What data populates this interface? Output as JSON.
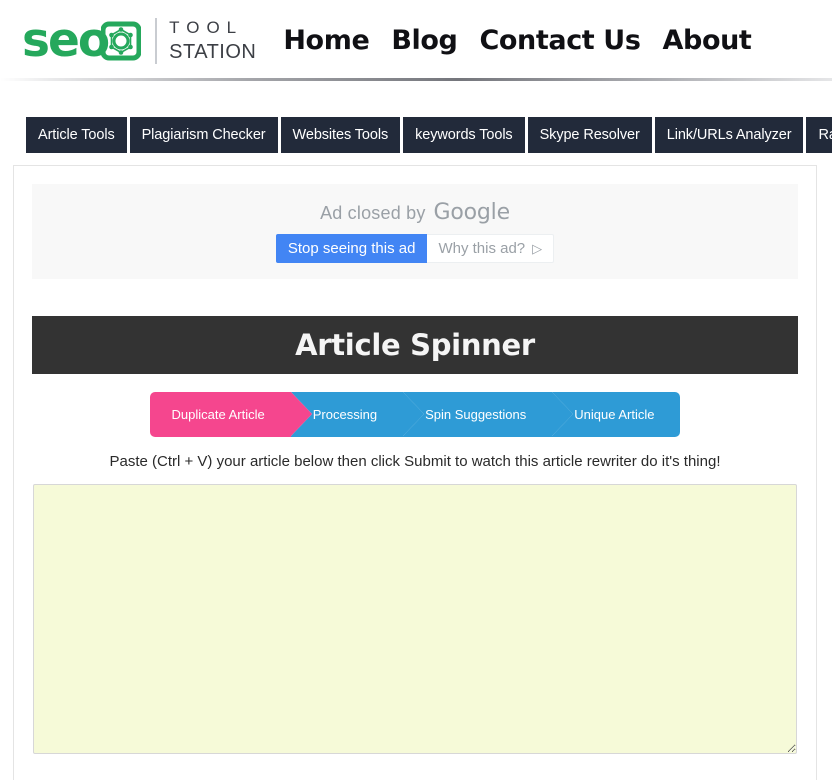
{
  "header": {
    "logo": {
      "seo_text": "seo",
      "tool_text": "TOOL",
      "station_text": "STATION",
      "brand_color": "#25a85c"
    },
    "nav": [
      {
        "label": "Home"
      },
      {
        "label": "Blog"
      },
      {
        "label": "Contact Us"
      },
      {
        "label": "About"
      }
    ]
  },
  "subnav": {
    "background": "#222a3a",
    "items": [
      {
        "label": "Article Tools"
      },
      {
        "label": "Plagiarism Checker"
      },
      {
        "label": "Websites Tools"
      },
      {
        "label": "keywords Tools"
      },
      {
        "label": "Skype Resolver"
      },
      {
        "label": "Link/URLs Analyzer"
      },
      {
        "label": "Ranke"
      }
    ]
  },
  "ad": {
    "closed_text": "Ad closed by",
    "google_label": "Google",
    "stop_button": "Stop seeing this ad",
    "why_button": "Why this ad?",
    "info_icon": "▷",
    "primary_color": "#4285f4",
    "text_color": "#9aa0a6"
  },
  "tool": {
    "title": "Article Spinner",
    "title_bg": "#333333",
    "steps": [
      {
        "label": "Duplicate Article",
        "state": "active",
        "color": "#f5468e"
      },
      {
        "label": "Processing",
        "state": "inactive",
        "color": "#2e9bd6"
      },
      {
        "label": "Spin Suggestions",
        "state": "inactive",
        "color": "#2e9bd6"
      },
      {
        "label": "Unique Article",
        "state": "inactive",
        "color": "#2e9bd6"
      }
    ],
    "instructions": "Paste (Ctrl + V) your article below then click Submit to watch this article rewriter do it's thing!",
    "editor": {
      "value": "",
      "placeholder": "",
      "background": "#f6fad8"
    }
  }
}
